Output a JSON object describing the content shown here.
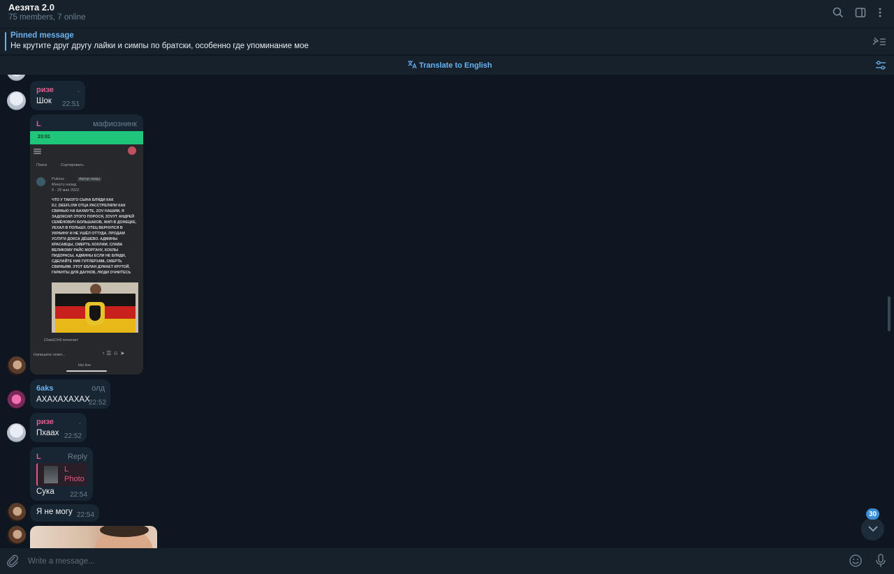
{
  "header": {
    "title": "Аезята 2.0",
    "subtitle": "75 members, 7 online",
    "icons": [
      "search-icon",
      "sidebar-icon",
      "more-icon"
    ]
  },
  "pinned": {
    "label": "Pinned message",
    "text": "Не крутите друг другу лайки и симпы по братски, особенно где упоминание мое"
  },
  "translate": {
    "label": "Translate to English"
  },
  "messages": [
    {
      "sender": "ризе",
      "tag": ".",
      "text": "Шок",
      "time": "22:51",
      "sender_color": "#e05d8f"
    },
    {
      "sender": "L",
      "tag": "мафиознинк",
      "sender_color": "#e05d8f",
      "screenshot": {
        "status_time": "23:01",
        "search": "Поиск",
        "sort": "Сортировать",
        "user": "Putinxx",
        "author_badge": "Автор темы",
        "ago": "Минуту назад",
        "stats": "9 · 29 мая 2022",
        "body": "ЧТО У ТАКОГО СЫНА БЛЯДИ КАК DJ_DEEFLOW ОТЦА РАССТРЕЛЯЛИ КАК СВИНЬЮ НА БАХМУТЕ, ZOV НАШИМ, Я ЗАДОКСИЛ ЭТОГО ПОРОСЯ, ZOVУТ АНДРЕЙ СЕМЁНОВИЧ БОЛЬШАКОВ, ЖИЛ В ДОНЕЦКЕ, УЕХАЛ В ПОЛЬШУ, ОТЕЦ ВЕРНУЛСЯ В УКРАИНУ И НЕ УШЁЛ ОТТУДА. ПРОДАМ УСЛУГИ ДОКСА ДЁШЕВО. АДМИНЫ КРАСАВЦЫ, СМЕРТЬ ХОХЛАМ. СЛАВА ВЕЛИКОМУ РАЙС МОРГАНУ, ХОХЛЫ ПИДОРАСЫ, АДМИНЫ ЕСЛИ НЕ БЛЯДИ, СДЕЛАЙТЕ НИК ГИТЛЕР1488, СМЕРТЬ СВИНЬЯМ. ЭТОТ ЕБЛАН ДУМАЕТ КРУТОЙ, ГАРАНТЫ ДЛЯ ДАУНОВ, ЛЮДИ ОЧНИТЕСЬ",
        "typing": "ChatsChill печатает",
        "reply_placeholder": "Напишите ответ...",
        "url": "lolz.live"
      }
    },
    {
      "sender": "6aks",
      "tag": "олд",
      "text": "АХАХАХАХАХ",
      "time": "22:52",
      "sender_color": "#6ab3f3"
    },
    {
      "sender": "ризе",
      "tag": ".",
      "text": "Пхаах",
      "time": "22:52",
      "sender_color": "#e05d8f"
    },
    {
      "sender": "L",
      "tag": "Reply",
      "reply_name": "L",
      "reply_label": "Photo",
      "text": "Сука",
      "time": "22:54",
      "sender_color": "#e05d8f"
    },
    {
      "text": "Я не могу",
      "time": "22:54"
    }
  ],
  "scroll": {
    "unread_count": "30"
  },
  "composer": {
    "placeholder": "Write a message..."
  },
  "colors": {
    "accent": "#6ab3f3",
    "background": "#0e1621",
    "panel": "#17212b",
    "bubble": "#182533",
    "pink": "#e05d8f"
  }
}
